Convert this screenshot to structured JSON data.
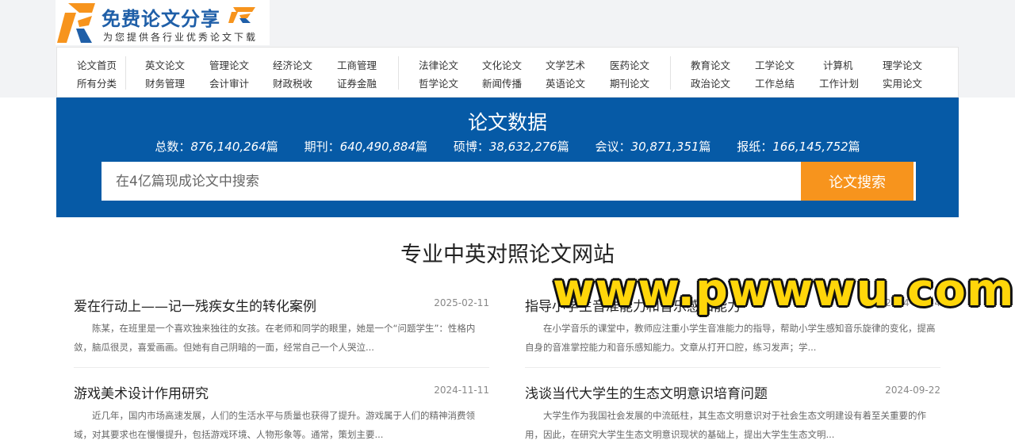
{
  "logo": {
    "title": "免费论文分享",
    "subtitle": "为您提供各行业优秀论文下载",
    "brand_orange": "#f7941d",
    "brand_blue": "#1f5fa8"
  },
  "nav": {
    "groups": [
      {
        "row1": [
          "论文首页",
          "英文论文",
          "管理论文",
          "经济论文",
          "工商管理"
        ],
        "row2": [
          "所有分类",
          "财务管理",
          "会计审计",
          "财政税收",
          "证券金融"
        ]
      },
      {
        "row1": [
          "法律论文",
          "文化论文",
          "文学艺术",
          "医药论文"
        ],
        "row2": [
          "哲学论文",
          "新闻传播",
          "英语论文",
          "期刊论文"
        ]
      },
      {
        "row1": [
          "教育论文",
          "工学论文",
          "计算机",
          "理学论文"
        ],
        "row2": [
          "政治论文",
          "工作总结",
          "工作计划",
          "实用论文"
        ]
      }
    ]
  },
  "hero": {
    "title": "论文数据",
    "bg_color": "#065aa6",
    "stats": [
      {
        "label": "总数：",
        "value": "876,140,264",
        "unit": "篇"
      },
      {
        "label": "期刊：",
        "value": "640,490,884",
        "unit": "篇"
      },
      {
        "label": "硕博：",
        "value": "38,632,276",
        "unit": "篇"
      },
      {
        "label": "会议：",
        "value": "30,871,351",
        "unit": "篇"
      },
      {
        "label": "报纸：",
        "value": "166,145,752",
        "unit": "篇"
      }
    ],
    "search": {
      "placeholder": "在4亿篇现成论文中搜索",
      "button_label": "论文搜索"
    }
  },
  "section_title": "专业中英对照论文网站",
  "articles": [
    {
      "title": "爱在行动上——记一残疾女生的转化案例",
      "date": "2025-02-11",
      "summary": "陈某，在班里是一个喜欢独来独往的女孩。在老师和同学的眼里，她是一个“问题学生”：性格内敛，脑瓜很灵，喜爱画画。但她有自己阴暗的一面，经常自己一个人哭泣..."
    },
    {
      "title": "指导小学生音准能力和音乐感知能力",
      "date": "2024-12-24",
      "summary": "在小学音乐的课堂中，教师应注重小学生音准能力的指导，帮助小学生感知音乐旋律的变化，提高自身的音准掌控能力和音乐感知能力。文章从打开口腔，练习发声；学..."
    },
    {
      "title": "游戏美术设计作用研究",
      "date": "2024-11-11",
      "summary": "近几年，国内市场高速发展，人们的生活水平与质量也获得了提升。游戏属于人们的精神消费领域，对其要求也在慢慢提升，包括游戏环境、人物形象等。通常，策划主要..."
    },
    {
      "title": "浅谈当代大学生的生态文明意识培育问题",
      "date": "2024-09-22",
      "summary": "大学生作为我国社会发展的中流砥柱，其生态文明意识对于社会生态文明建设有着至关重要的作用，因此，在研究大学生生态文明意识现状的基础上，提出大学生生态文明..."
    }
  ],
  "watermark": "www.pwwwu.com"
}
